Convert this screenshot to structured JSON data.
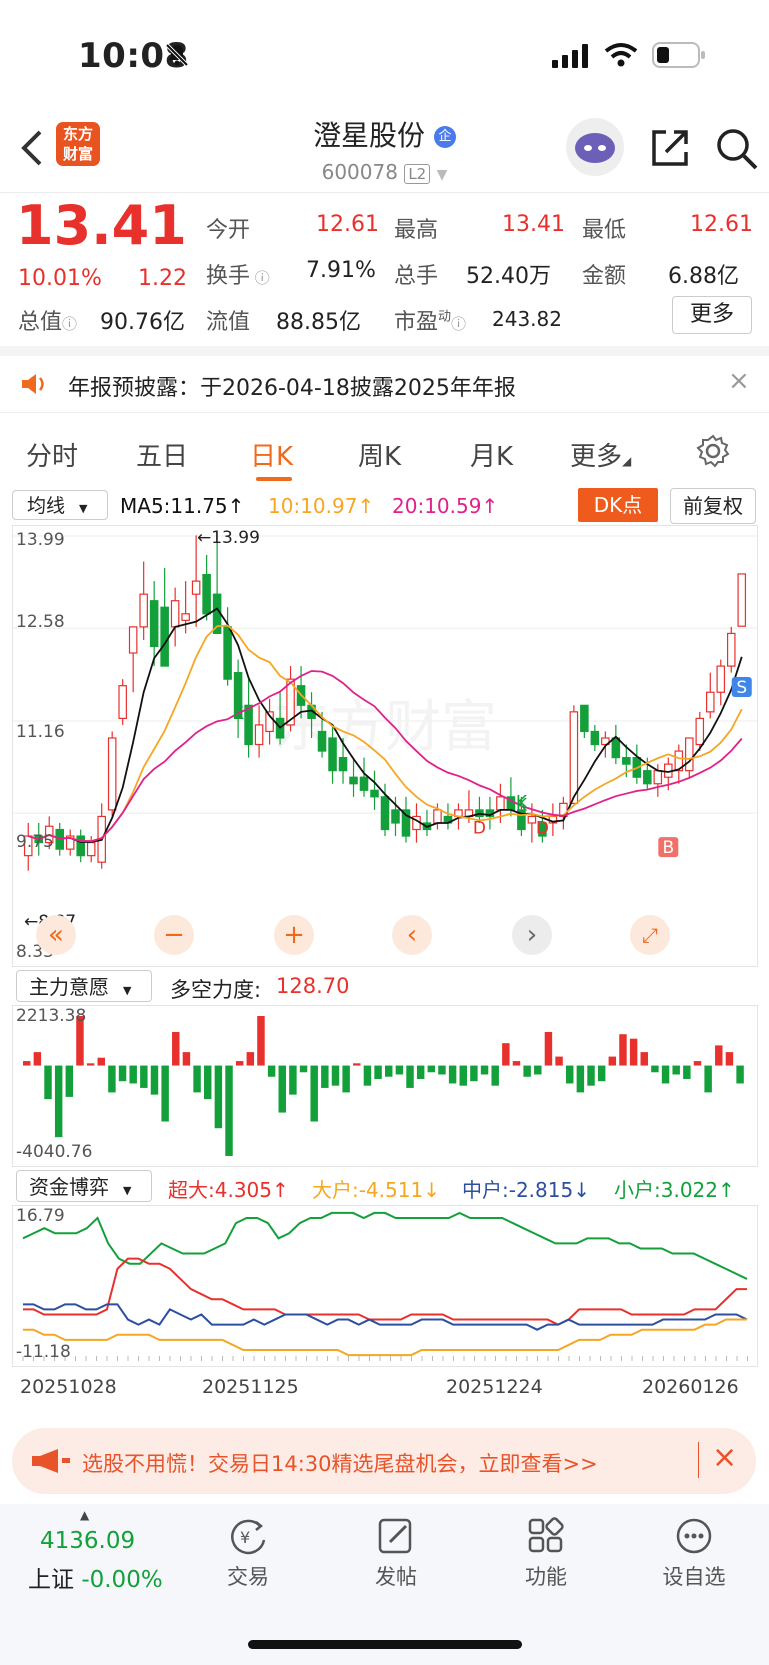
{
  "status": {
    "time": "10:08"
  },
  "header": {
    "logo_text_1": "东方",
    "logo_text_2": "财富",
    "stock_name": "澄星股份",
    "stock_code": "600078",
    "level_badge": "L2",
    "ent_badge": "企"
  },
  "quote": {
    "price": "13.41",
    "change_pct": "10.01%",
    "change_abs": "1.22",
    "open_label": "今开",
    "open": "12.61",
    "high_label": "最高",
    "high": "13.41",
    "low_label": "最低",
    "low": "12.61",
    "turnover_label": "换手",
    "turnover": "7.91%",
    "volume_label": "总手",
    "volume": "52.40万",
    "amount_label": "金额",
    "amount": "6.88亿",
    "mktcap_label": "总值",
    "mktcap": "90.76亿",
    "float_label": "流值",
    "float_cap": "88.85亿",
    "pe_label": "市盈",
    "pe_sup": "动",
    "pe": "243.82",
    "more_button": "更多"
  },
  "notice": {
    "text": "年报预披露：于2026-04-18披露2025年年报"
  },
  "tabs": [
    "分时",
    "五日",
    "日K",
    "周K",
    "月K",
    "更多"
  ],
  "active_tab": 2,
  "kline": {
    "indicator_select": "均线",
    "ma5": "MA5:11.75↑",
    "ma10": "10:10.97↑",
    "ma20": "20:10.59↑",
    "dk_button": "DK点",
    "adjust_button": "前复权",
    "y_labels": [
      "13.99",
      "12.58",
      "11.16",
      "9.75",
      "8.33"
    ],
    "max_label": "←13.99",
    "min_label": "←8.87",
    "markers": [
      "K",
      "K",
      "D",
      "D",
      "K",
      "S",
      "B"
    ],
    "watermark": "东方财富"
  },
  "indicator1": {
    "select": "主力意愿",
    "label": "多空力度:",
    "value": "128.70",
    "ymax": "2213.38",
    "ymin": "-4040.76"
  },
  "indicator2": {
    "select": "资金博弈",
    "super": "超大:4.305↑",
    "large": "大户:-4.511↓",
    "medium": "中户:-2.815↓",
    "small": "小户:3.022↑",
    "ymax": "16.79",
    "ymin": "-11.18"
  },
  "x_dates": [
    "20251028",
    "20251125",
    "20251224",
    "20260126"
  ],
  "banner": {
    "text": "选股不用慌！交易日14:30精选尾盘机会，立即查看>>"
  },
  "bottom_nav": {
    "index_value": "4136.09",
    "index_name": "上证",
    "index_change": "-0.00%",
    "items": [
      "交易",
      "发帖",
      "功能",
      "设自选"
    ]
  },
  "colors": {
    "up": "#e8302c",
    "down": "#13a03a",
    "accent": "#ef6a1d",
    "ma5": "#111111",
    "ma10": "#f5a623",
    "ma20": "#e0218a"
  },
  "chart_data": {
    "type": "candlestick",
    "ylim": [
      8.33,
      13.99
    ],
    "candles": [
      [
        9.1,
        9.6,
        8.87,
        9.4
      ],
      [
        9.4,
        9.6,
        9.1,
        9.3
      ],
      [
        9.3,
        9.7,
        9.2,
        9.55
      ],
      [
        9.5,
        9.6,
        9.1,
        9.2
      ],
      [
        9.2,
        9.5,
        9.1,
        9.4
      ],
      [
        9.4,
        9.5,
        9.0,
        9.1
      ],
      [
        9.1,
        9.4,
        9.0,
        9.3
      ],
      [
        9.0,
        9.9,
        8.9,
        9.7
      ],
      [
        9.8,
        11.0,
        9.7,
        10.9
      ],
      [
        11.2,
        11.8,
        11.1,
        11.7
      ],
      [
        12.2,
        12.6,
        11.6,
        12.6
      ],
      [
        12.6,
        13.6,
        12.4,
        13.1
      ],
      [
        13.0,
        13.3,
        12.0,
        12.3
      ],
      [
        12.9,
        13.5,
        12.0,
        12.0
      ],
      [
        12.6,
        13.2,
        12.3,
        13.0
      ],
      [
        12.7,
        13.3,
        12.5,
        12.8
      ],
      [
        13.1,
        14.0,
        12.6,
        13.3
      ],
      [
        13.4,
        13.7,
        12.7,
        12.8
      ],
      [
        13.1,
        13.9,
        12.7,
        12.5
      ],
      [
        12.6,
        12.9,
        11.7,
        11.8
      ],
      [
        11.9,
        12.1,
        10.9,
        11.2
      ],
      [
        11.4,
        11.8,
        10.6,
        10.8
      ],
      [
        10.8,
        11.4,
        10.6,
        11.1
      ],
      [
        11.0,
        11.5,
        10.8,
        11.3
      ],
      [
        11.2,
        11.6,
        10.8,
        10.9
      ],
      [
        11.1,
        12.0,
        11.0,
        11.8
      ],
      [
        11.7,
        12.0,
        11.2,
        11.4
      ],
      [
        11.4,
        11.6,
        10.9,
        11.2
      ],
      [
        11.0,
        11.3,
        10.6,
        10.7
      ],
      [
        10.9,
        11.1,
        10.2,
        10.4
      ],
      [
        10.6,
        10.9,
        10.2,
        10.4
      ],
      [
        10.3,
        10.6,
        10.0,
        10.2
      ],
      [
        10.3,
        10.6,
        10.0,
        10.1
      ],
      [
        10.1,
        10.4,
        9.8,
        10.0
      ],
      [
        10.0,
        10.2,
        9.4,
        9.5
      ],
      [
        9.8,
        10.0,
        9.4,
        9.6
      ],
      [
        9.8,
        10.0,
        9.3,
        9.4
      ],
      [
        9.5,
        9.9,
        9.3,
        9.7
      ],
      [
        9.6,
        9.8,
        9.4,
        9.5
      ],
      [
        9.6,
        9.9,
        9.5,
        9.8
      ],
      [
        9.7,
        9.9,
        9.5,
        9.6
      ],
      [
        9.7,
        9.9,
        9.5,
        9.8
      ],
      [
        9.7,
        10.1,
        9.6,
        9.8
      ],
      [
        9.8,
        10.0,
        9.6,
        9.7
      ],
      [
        9.8,
        10.0,
        9.5,
        9.7
      ],
      [
        9.8,
        10.2,
        9.6,
        10.0
      ],
      [
        10.0,
        10.3,
        9.7,
        9.8
      ],
      [
        9.8,
        10.0,
        9.4,
        9.5
      ],
      [
        9.6,
        9.9,
        9.3,
        9.7
      ],
      [
        9.6,
        9.8,
        9.3,
        9.4
      ],
      [
        9.6,
        9.9,
        9.4,
        9.7
      ],
      [
        9.7,
        10.0,
        9.5,
        9.9
      ],
      [
        9.9,
        11.4,
        9.9,
        11.3
      ],
      [
        11.4,
        11.4,
        10.9,
        11.0
      ],
      [
        11.0,
        11.1,
        10.7,
        10.8
      ],
      [
        10.8,
        11.0,
        10.6,
        10.9
      ],
      [
        10.9,
        11.1,
        10.5,
        10.6
      ],
      [
        10.6,
        10.8,
        10.3,
        10.5
      ],
      [
        10.6,
        10.8,
        10.2,
        10.3
      ],
      [
        10.4,
        10.6,
        10.1,
        10.2
      ],
      [
        10.2,
        10.5,
        10.0,
        10.4
      ],
      [
        10.3,
        10.6,
        10.1,
        10.5
      ],
      [
        10.4,
        10.8,
        10.2,
        10.7
      ],
      [
        10.4,
        10.9,
        10.3,
        10.9
      ],
      [
        10.8,
        11.3,
        10.7,
        11.2
      ],
      [
        11.3,
        11.9,
        11.2,
        11.6
      ],
      [
        11.6,
        12.1,
        11.4,
        12.0
      ],
      [
        12.0,
        12.6,
        11.9,
        12.5
      ],
      [
        12.61,
        13.41,
        12.61,
        13.41
      ]
    ]
  }
}
